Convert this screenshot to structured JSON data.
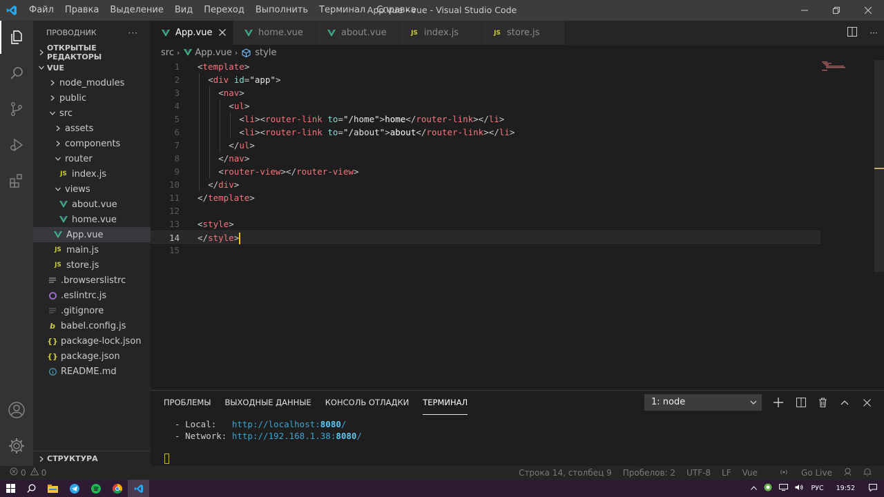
{
  "window": {
    "title": "App.vue - vue - Visual Studio Code",
    "menu": [
      "Файл",
      "Правка",
      "Выделение",
      "Вид",
      "Переход",
      "Выполнить",
      "Терминал",
      "Справка"
    ]
  },
  "sidebar": {
    "title": "ПРОВОДНИК",
    "more": "···",
    "open_editors": "ОТКРЫТЫЕ РЕДАКТОРЫ",
    "root": "VUE",
    "tree": [
      {
        "label": "node_modules",
        "type": "folder",
        "depth": 1,
        "expanded": false
      },
      {
        "label": "public",
        "type": "folder",
        "depth": 1,
        "expanded": false
      },
      {
        "label": "src",
        "type": "folder",
        "depth": 1,
        "expanded": true
      },
      {
        "label": "assets",
        "type": "folder",
        "depth": 2,
        "expanded": false
      },
      {
        "label": "components",
        "type": "folder",
        "depth": 2,
        "expanded": false
      },
      {
        "label": "router",
        "type": "folder",
        "depth": 2,
        "expanded": true
      },
      {
        "label": "index.js",
        "type": "js",
        "depth": 3
      },
      {
        "label": "views",
        "type": "folder",
        "depth": 2,
        "expanded": true
      },
      {
        "label": "about.vue",
        "type": "vue",
        "depth": 3
      },
      {
        "label": "home.vue",
        "type": "vue",
        "depth": 3
      },
      {
        "label": "App.vue",
        "type": "vue",
        "depth": 2,
        "selected": true
      },
      {
        "label": "main.js",
        "type": "js",
        "depth": 2
      },
      {
        "label": "store.js",
        "type": "js",
        "depth": 2
      },
      {
        "label": ".browserslistrc",
        "type": "lines",
        "depth": 1
      },
      {
        "label": ".eslintrc.js",
        "type": "eslint",
        "depth": 1
      },
      {
        "label": ".gitignore",
        "type": "git",
        "depth": 1
      },
      {
        "label": "babel.config.js",
        "type": "babel",
        "depth": 1
      },
      {
        "label": "package-lock.json",
        "type": "json",
        "depth": 1
      },
      {
        "label": "package.json",
        "type": "json",
        "depth": 1
      },
      {
        "label": "README.md",
        "type": "info",
        "depth": 1
      }
    ],
    "outline": "СТРУКТУРА"
  },
  "tabs": [
    {
      "label": "App.vue",
      "type": "vue",
      "active": true
    },
    {
      "label": "home.vue",
      "type": "vue"
    },
    {
      "label": "about.vue",
      "type": "vue"
    },
    {
      "label": "index.js",
      "type": "js"
    },
    {
      "label": "store.js",
      "type": "js"
    }
  ],
  "breadcrumb": {
    "folder": "src",
    "file": "App.vue",
    "symbol": "style"
  },
  "editor": {
    "current_line": 14,
    "lines": [
      {
        "n": "1",
        "indent": 0,
        "parts": [
          [
            "ang",
            "<"
          ],
          [
            "tg",
            "template"
          ],
          [
            "ang",
            ">"
          ]
        ]
      },
      {
        "n": "2",
        "indent": 1,
        "parts": [
          [
            "ang",
            "<"
          ],
          [
            "tg",
            "div"
          ],
          [
            "ang",
            " "
          ],
          [
            "at",
            "id"
          ],
          [
            "ang",
            "="
          ],
          [
            "st",
            "\"app\""
          ],
          [
            "ang",
            ">"
          ]
        ]
      },
      {
        "n": "3",
        "indent": 2,
        "parts": [
          [
            "ang",
            "<"
          ],
          [
            "tg",
            "nav"
          ],
          [
            "ang",
            ">"
          ]
        ]
      },
      {
        "n": "4",
        "indent": 3,
        "parts": [
          [
            "ang",
            "<"
          ],
          [
            "tg",
            "ul"
          ],
          [
            "ang",
            ">"
          ]
        ]
      },
      {
        "n": "5",
        "indent": 4,
        "parts": [
          [
            "ang",
            "<"
          ],
          [
            "tg",
            "li"
          ],
          [
            "ang",
            "><"
          ],
          [
            "tg",
            "router-link"
          ],
          [
            "ang",
            " "
          ],
          [
            "at",
            "to"
          ],
          [
            "ang",
            "="
          ],
          [
            "st",
            "\"/home\""
          ],
          [
            "ang",
            ">"
          ],
          [
            "tx",
            "home"
          ],
          [
            "ang",
            "</"
          ],
          [
            "tg",
            "router-link"
          ],
          [
            "ang",
            "></"
          ],
          [
            "tg",
            "li"
          ],
          [
            "ang",
            ">"
          ]
        ]
      },
      {
        "n": "6",
        "indent": 4,
        "parts": [
          [
            "ang",
            "<"
          ],
          [
            "tg",
            "li"
          ],
          [
            "ang",
            "><"
          ],
          [
            "tg",
            "router-link"
          ],
          [
            "ang",
            " "
          ],
          [
            "at",
            "to"
          ],
          [
            "ang",
            "="
          ],
          [
            "st",
            "\"/about\""
          ],
          [
            "ang",
            ">"
          ],
          [
            "tx",
            "about"
          ],
          [
            "ang",
            "</"
          ],
          [
            "tg",
            "router-link"
          ],
          [
            "ang",
            "></"
          ],
          [
            "tg",
            "li"
          ],
          [
            "ang",
            ">"
          ]
        ]
      },
      {
        "n": "7",
        "indent": 3,
        "parts": [
          [
            "ang",
            "</"
          ],
          [
            "tg",
            "ul"
          ],
          [
            "ang",
            ">"
          ]
        ]
      },
      {
        "n": "8",
        "indent": 2,
        "parts": [
          [
            "ang",
            "</"
          ],
          [
            "tg",
            "nav"
          ],
          [
            "ang",
            ">"
          ]
        ]
      },
      {
        "n": "9",
        "indent": 2,
        "parts": [
          [
            "ang",
            "<"
          ],
          [
            "tg",
            "router-view"
          ],
          [
            "ang",
            "></"
          ],
          [
            "tg",
            "router-view"
          ],
          [
            "ang",
            ">"
          ]
        ]
      },
      {
        "n": "10",
        "indent": 1,
        "parts": [
          [
            "ang",
            "</"
          ],
          [
            "tg",
            "div"
          ],
          [
            "ang",
            ">"
          ]
        ]
      },
      {
        "n": "11",
        "indent": 0,
        "parts": [
          [
            "ang",
            "</"
          ],
          [
            "tg",
            "template"
          ],
          [
            "ang",
            ">"
          ]
        ]
      },
      {
        "n": "12",
        "indent": 0,
        "parts": []
      },
      {
        "n": "13",
        "indent": 0,
        "parts": [
          [
            "ang",
            "<"
          ],
          [
            "tg",
            "style"
          ],
          [
            "ang",
            ">"
          ]
        ]
      },
      {
        "n": "14",
        "indent": 0,
        "parts": [
          [
            "ang",
            "</"
          ],
          [
            "tg",
            "style"
          ],
          [
            "ang",
            ">"
          ]
        ]
      },
      {
        "n": "15",
        "indent": 0,
        "parts": []
      }
    ]
  },
  "panel": {
    "tabs": [
      "ПРОБЛЕМЫ",
      "ВЫХОДНЫЕ ДАННЫЕ",
      "КОНСОЛЬ ОТЛАДКИ",
      "ТЕРМИНАЛ"
    ],
    "active_tab": 3,
    "terminal_select": "1: node",
    "local_label": "  - Local:   ",
    "local_url": "http://localhost:",
    "local_port": "8080",
    "local_tail": "/",
    "network_label": "  - Network: ",
    "network_url": "http://192.168.1.38:",
    "network_port": "8080",
    "network_tail": "/"
  },
  "statusbar": {
    "errors": "0",
    "warnings": "0",
    "position": "Строка 14, столбец 9",
    "spaces": "Пробелов: 2",
    "encoding": "UTF-8",
    "eol": "LF",
    "language": "Vue",
    "golive": "Go Live"
  },
  "taskbar": {
    "lang": "РУС",
    "time": "19:52"
  },
  "colors": {
    "vue_green": "#41b883",
    "js_yellow": "#cbcb41",
    "accent": "#007acc"
  }
}
